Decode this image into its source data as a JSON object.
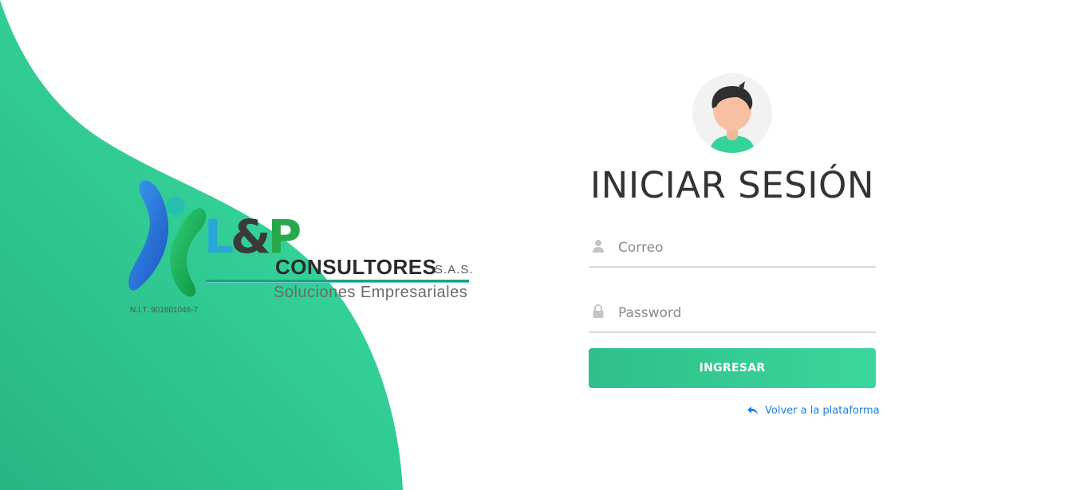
{
  "brand": {
    "logo_L": "L",
    "logo_amp": "&",
    "logo_P": "P",
    "name": "CONSULTORES",
    "suffix": "S.A.S.",
    "tagline": "Soluciones Empresariales",
    "nit": "N.I.T. 901601046-7"
  },
  "login": {
    "title": "INICIAR SESIÓN",
    "email_placeholder": "Correo",
    "password_placeholder": "Password",
    "submit_label": "INGRESAR",
    "back_link": "Volver a la plataforma"
  },
  "icons": {
    "user": "user-icon",
    "lock": "lock-icon",
    "back": "reply-arrow-icon"
  },
  "colors": {
    "accent": "#34d399",
    "accent_dark": "#2fbf8a",
    "link": "#1a7fe0"
  }
}
